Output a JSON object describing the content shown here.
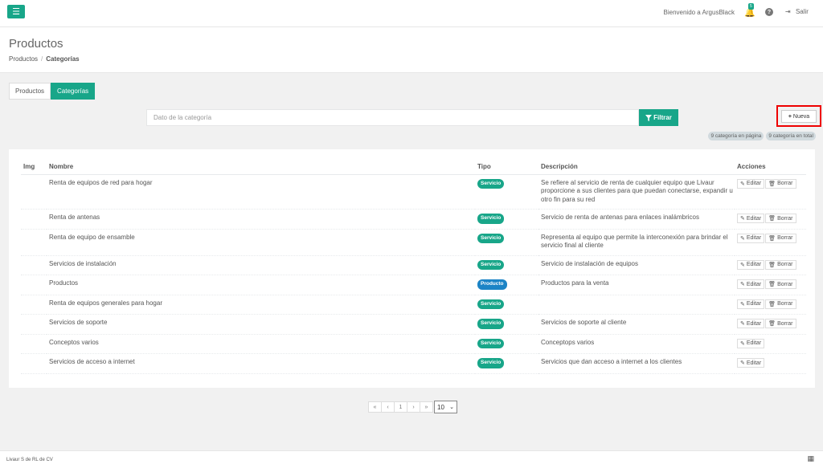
{
  "header": {
    "menu_icon": "☰",
    "welcome": "Bienvenido a ArgusBlack",
    "notification_count": "5",
    "help_icon": "?",
    "logout_label": "Salir"
  },
  "page": {
    "title": "Productos",
    "breadcrumb": [
      "Productos",
      "Categorías"
    ]
  },
  "tabs": [
    {
      "label": "Productos",
      "active": false
    },
    {
      "label": "Categorías",
      "active": true
    }
  ],
  "search": {
    "placeholder": "Dato de la categoría",
    "filter_label": "Filtrar",
    "new_label": "Nueva"
  },
  "counts": {
    "on_page": "9 categoría en página",
    "total": "9 categoría en total"
  },
  "table": {
    "columns": [
      "Img",
      "Nombre",
      "Tipo",
      "Descripción",
      "Acciones"
    ],
    "edit_label": "Editar",
    "delete_label": "Borrar",
    "rows": [
      {
        "nombre": "Renta de equipos de red para hogar",
        "tipo": "Servicio",
        "descripcion": "Se refiere al servicio de renta de cualquier equipo que Livaur proporcione a sus clientes para que puedan conectarse, expandir u otro fin para su red",
        "delete": true
      },
      {
        "nombre": "Renta de antenas",
        "tipo": "Servicio",
        "descripcion": "Servicio de renta de antenas para enlaces inalámbricos",
        "delete": true
      },
      {
        "nombre": "Renta de equipo de ensamble",
        "tipo": "Servicio",
        "descripcion": "Representa al equipo que permite la interconexión para brindar el servicio final al cliente",
        "delete": true
      },
      {
        "nombre": "Servicios de instalación",
        "tipo": "Servicio",
        "descripcion": "Servicio de instalación de equipos",
        "delete": true
      },
      {
        "nombre": "Productos",
        "tipo": "Producto",
        "descripcion": "Productos para la venta",
        "delete": true
      },
      {
        "nombre": "Renta de equipos generales para hogar",
        "tipo": "Servicio",
        "descripcion": "",
        "delete": true
      },
      {
        "nombre": "Servicios de soporte",
        "tipo": "Servicio",
        "descripcion": "Servicios de soporte al cliente",
        "delete": true
      },
      {
        "nombre": "Conceptos varios",
        "tipo": "Servicio",
        "descripcion": "Conceptops varios",
        "delete": false
      },
      {
        "nombre": "Servicios de acceso a internet",
        "tipo": "Servicio",
        "descripcion": "Servicios que dan acceso a internet a los clientes",
        "delete": false
      }
    ]
  },
  "pagination": {
    "first": "«",
    "prev": "‹",
    "current": "1",
    "next": "›",
    "last": "»",
    "per_page": "10"
  },
  "footer": {
    "text": "Livaur S de RL de CV"
  },
  "colors": {
    "primary": "#18a689",
    "product": "#1c84c6",
    "highlight": "#ee0000"
  }
}
